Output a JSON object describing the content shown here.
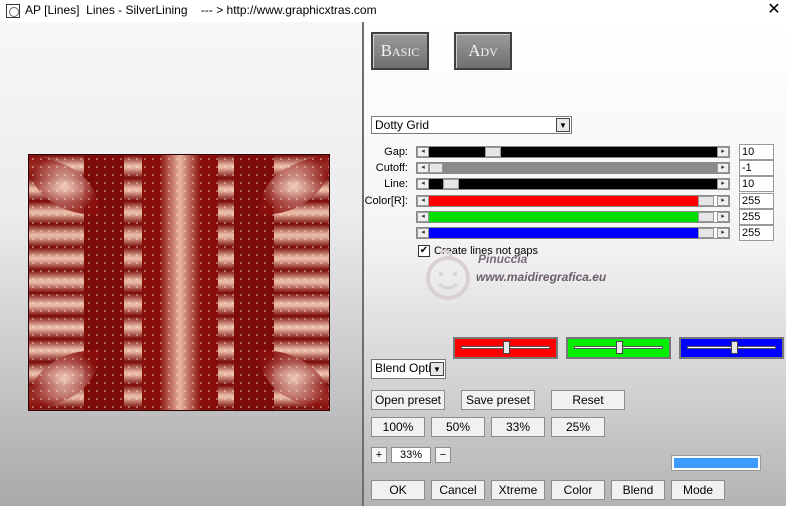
{
  "window": {
    "title": "AP [Lines]  Lines - SilverLining    --- > http://www.graphicxtras.com",
    "close_glyph": "✕"
  },
  "tabs": [
    {
      "label": "Basic"
    },
    {
      "label": "Adv"
    }
  ],
  "mode_select": {
    "value": "Dotty Grid",
    "arrow": "▼"
  },
  "sliders": {
    "gap": {
      "label": "Gap:",
      "value": "10"
    },
    "cutoff": {
      "label": "Cutoff:",
      "value": "-1"
    },
    "line": {
      "label": "Line:",
      "value": "10"
    },
    "color_r": {
      "label": "Color[R]:",
      "value": "255",
      "color": "#ff0000"
    },
    "color_g": {
      "value": "255",
      "color": "#00dd00"
    },
    "color_b": {
      "value": "255",
      "color": "#0000ff"
    }
  },
  "options": {
    "create_lines_label": "Create lines not gaps",
    "create_lines_checked": true,
    "check_glyph": "✔"
  },
  "watermark": {
    "line1": "Pinuccia",
    "line2": "www.maidiregrafica.eu"
  },
  "blend_select": {
    "value": "Blend Opti",
    "arrow": "▼"
  },
  "channel_colors": {
    "red": "#ff0000",
    "green": "#00ee00",
    "blue": "#0000ff"
  },
  "preset_buttons": {
    "open": "Open preset",
    "save": "Save preset",
    "reset": "Reset"
  },
  "zoom_buttons": [
    "100%",
    "50%",
    "33%",
    "25%"
  ],
  "zoom": {
    "plus": "+",
    "value": "33%",
    "minus": "−"
  },
  "accent_color": "#3d9bff",
  "bottom_buttons": {
    "ok": "OK",
    "cancel": "Cancel",
    "xtreme": "Xtreme",
    "color": "Color",
    "blend": "Blend",
    "mode": "Mode"
  }
}
